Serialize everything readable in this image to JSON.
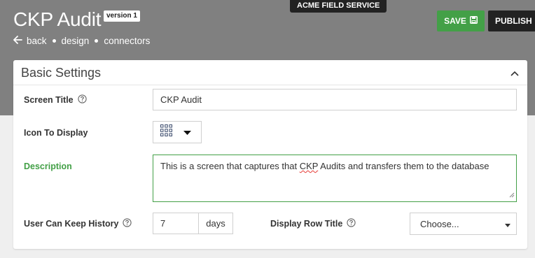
{
  "header": {
    "app_title": "CKP Audit",
    "version_badge": "version 1",
    "company_pill": "ACME FIELD SERVICE",
    "breadcrumb": {
      "back": "back",
      "design": "design",
      "connectors": "connectors"
    },
    "save_label": "SAVE",
    "publish_label": "PUBLISH"
  },
  "card": {
    "title": "Basic Settings",
    "fields": {
      "screen_title": {
        "label": "Screen Title",
        "value": "CKP Audit"
      },
      "icon_to_display": {
        "label": "Icon To Display",
        "icon": "grid-icon"
      },
      "description": {
        "label": "Description",
        "value_pre": "This is a screen that captures that ",
        "value_flag": "CKP",
        "value_post": " Audits and transfers them to the database"
      },
      "history": {
        "label": "User Can Keep History",
        "value": "7",
        "unit": "days"
      },
      "display_row_title": {
        "label": "Display Row Title",
        "selected": "Choose..."
      }
    }
  },
  "colors": {
    "header_band": "#808080",
    "accent_green": "#43a047",
    "dark": "#222222"
  }
}
